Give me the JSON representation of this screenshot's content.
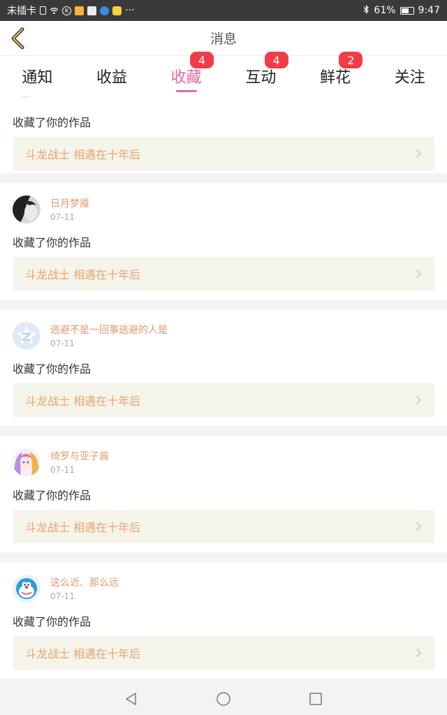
{
  "status_bar": {
    "carrier": "未插卡",
    "battery": "61%",
    "time": "9:47"
  },
  "header": {
    "title": "消息"
  },
  "tabs": [
    {
      "label": "通知",
      "badge": ""
    },
    {
      "label": "收益",
      "badge": ""
    },
    {
      "label": "收藏",
      "badge": "4",
      "active": true
    },
    {
      "label": "互动",
      "badge": "4"
    },
    {
      "label": "鲜花",
      "badge": "2"
    },
    {
      "label": "关注",
      "badge": ""
    }
  ],
  "partial_item": {
    "action": "收藏了你的作品",
    "work": "斗龙战士 相遇在十年后"
  },
  "items": [
    {
      "name": "日月梦魇",
      "date": "07-11",
      "action": "收藏了你的作品",
      "work": "斗龙战士 相遇在十年后",
      "avatar": "portrait"
    },
    {
      "name": "逃避不是一回事逃避的人是",
      "date": "07-11",
      "action": "收藏了你的作品",
      "work": "斗龙战士 相遇在十年后",
      "avatar": "default"
    },
    {
      "name": "绮罗与亚子酱",
      "date": "07-11",
      "action": "收藏了你的作品",
      "work": "斗龙战士 相遇在十年后",
      "avatar": "anime"
    },
    {
      "name": "这么近、那么远",
      "date": "07-11",
      "action": "收藏了你的作品",
      "work": "斗龙战士 相遇在十年后",
      "avatar": "doraemon"
    }
  ],
  "colors": {
    "accent": "#e16aa1",
    "badge": "#f23c45",
    "username": "#e39a6f",
    "work_title": "#e8a56c",
    "work_bg": "#f5f4ea"
  }
}
